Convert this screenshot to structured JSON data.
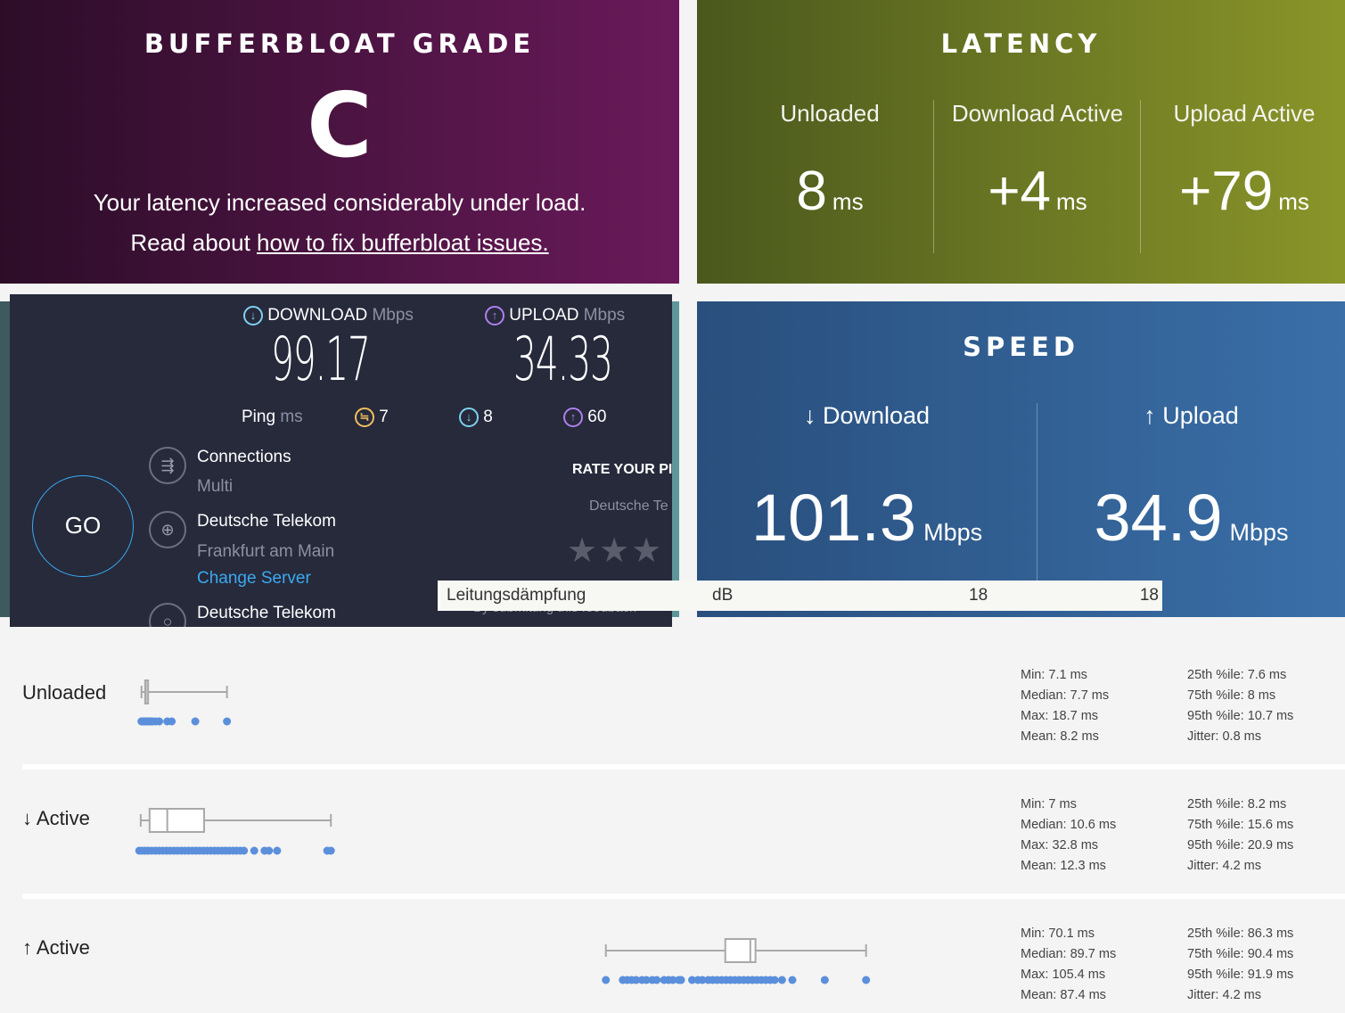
{
  "bufferbloat": {
    "title": "BUFFERBLOAT GRADE",
    "grade": "C",
    "message": "Your latency increased considerably under load.",
    "read_prefix": "Read about ",
    "link": "how to fix bufferbloat issues."
  },
  "latency": {
    "title": "LATENCY",
    "cols": [
      {
        "label": "Unloaded",
        "value": "8",
        "unit": "ms"
      },
      {
        "label": "Download Active",
        "value": "+4",
        "unit": "ms"
      },
      {
        "label": "Upload Active",
        "value": "+79",
        "unit": "ms"
      }
    ]
  },
  "ookla": {
    "download_label": "DOWNLOAD",
    "upload_label": "UPLOAD",
    "unit": "Mbps",
    "download": "99.17",
    "upload": "34.33",
    "ping_label": "Ping",
    "ping_unit": "ms",
    "ping_idle": "7",
    "ping_down": "8",
    "ping_up": "60",
    "go": "GO",
    "connections_label": "Connections",
    "connections_value": "Multi",
    "isp": "Deutsche Telekom",
    "server_location": "Frankfurt am Main",
    "change_server": "Change Server",
    "host": "Deutsche Telekom",
    "rate_label": "RATE YOUR PI",
    "rate_provider": "Deutsche Te",
    "feedback": "By submitting this feedback",
    "stars": 3,
    "colors": {
      "download": "#7fd0f0",
      "upload": "#b07ff0",
      "ping": "#f0c060",
      "link": "#3ba9f0"
    }
  },
  "speed": {
    "title": "SPEED",
    "download_label": "↓ Download",
    "upload_label": "↑ Upload",
    "download": "101.3",
    "upload": "34.9",
    "unit": "Mbps"
  },
  "tooltip": {
    "label": "Leitungsdämpfung",
    "unit": "dB",
    "v1": "18",
    "v2": "18"
  },
  "rows": [
    {
      "label": "Unloaded",
      "box": {
        "min": 7.1,
        "q1": 7.6,
        "median": 7.7,
        "q3": 8,
        "max": 18.7
      },
      "points": [
        7.1,
        7.2,
        7.3,
        7.4,
        7.5,
        7.6,
        7.7,
        7.8,
        7.9,
        8.0,
        8.2,
        8.4,
        8.6,
        9.0,
        9.5,
        10.6,
        11.2,
        14.4,
        18.7
      ],
      "stats": [
        "Min: 7.1 ms",
        "Median: 7.7 ms",
        "Max: 18.7 ms",
        "Mean: 8.2 ms"
      ],
      "pct": [
        "25th %ile: 7.6 ms",
        "75th %ile: 8 ms",
        "95th %ile: 10.7 ms",
        "Jitter: 0.8 ms"
      ]
    },
    {
      "label": "↓ Active",
      "box": {
        "min": 7,
        "q1": 8.2,
        "median": 10.6,
        "q3": 15.6,
        "max": 32.8
      },
      "points": [
        6.8,
        7.2,
        7.6,
        8,
        8.5,
        9,
        9.5,
        10,
        10.5,
        11,
        11.5,
        12,
        12.5,
        13,
        13.5,
        14,
        14.5,
        15,
        15.5,
        16,
        16.5,
        17,
        17.5,
        18,
        18.5,
        19,
        19.5,
        20,
        20.5,
        21,
        22.4,
        23.8,
        24.4,
        25.5,
        32.3,
        32.8
      ],
      "stats": [
        "Min: 7 ms",
        "Median: 10.6 ms",
        "Max: 32.8 ms",
        "Mean: 12.3 ms"
      ],
      "pct": [
        "25th %ile: 8.2 ms",
        "75th %ile: 15.6 ms",
        "95th %ile: 20.9 ms",
        "Jitter: 4.2 ms"
      ]
    },
    {
      "label": "↑ Active",
      "box": {
        "min": 70.1,
        "q1": 86.3,
        "median": 89.7,
        "q3": 90.4,
        "max": 105.4
      },
      "points": [
        70.1,
        72.4,
        73,
        73.6,
        74.2,
        75,
        75.6,
        76.4,
        77,
        78,
        78.6,
        79.2,
        80,
        80.3,
        81.8,
        82.6,
        83.2,
        84,
        84.6,
        85.2,
        85.8,
        86.4,
        87,
        87.6,
        88.2,
        88.8,
        89.4,
        90,
        90.6,
        91.2,
        91.8,
        92.4,
        93,
        94,
        95.4,
        99.8,
        105.4
      ],
      "stats": [
        "Min: 70.1 ms",
        "Median: 89.7 ms",
        "Max: 105.4 ms",
        "Mean: 87.4 ms"
      ],
      "pct": [
        "25th %ile: 86.3 ms",
        "75th %ile: 90.4 ms",
        "95th %ile: 91.9 ms",
        "Jitter: 4.2 ms"
      ]
    }
  ],
  "colors": {
    "dots": "#5b8fdb",
    "box": "#a9a9a9"
  }
}
